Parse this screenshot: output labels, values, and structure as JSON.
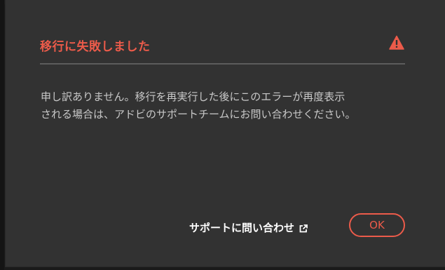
{
  "dialog": {
    "title": "移行に失敗しました",
    "alert_icon": "alert-triangle-icon",
    "message_lines": [
      "申し訳ありません。移行を再実行した後にこのエラーが再度表示",
      "される場合は、アドビのサポートチームにお問い合わせください。"
    ],
    "support_link_label": "サポートに問い合わせ",
    "external_link_icon": "external-link-icon",
    "ok_label": "OK"
  },
  "colors": {
    "accent": "#ec5b4a",
    "dialog_bg": "#323232",
    "text": "#c8c8c8",
    "link_text": "#ffffff",
    "divider": "#5c5c5c"
  }
}
